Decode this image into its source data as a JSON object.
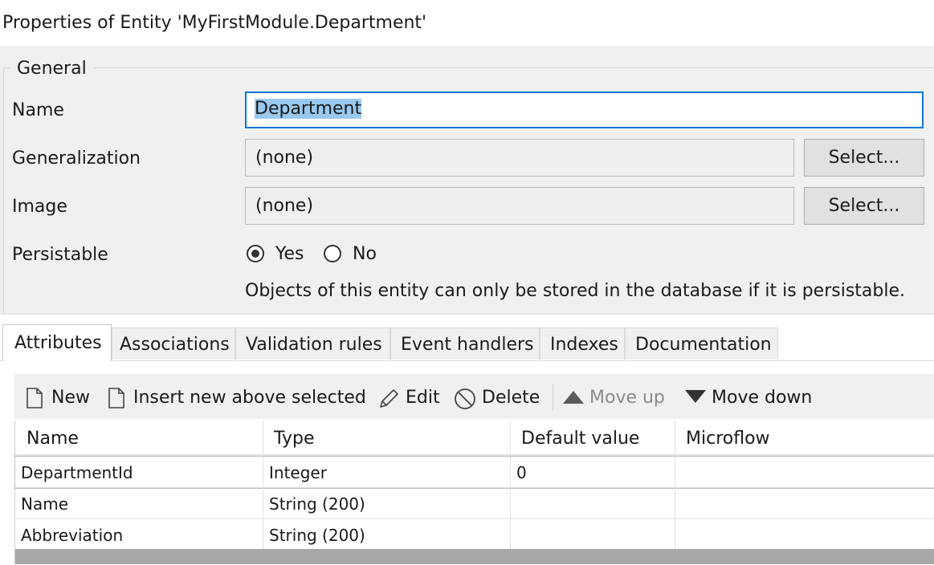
{
  "window": {
    "title": "Properties of Entity 'MyFirstModule.Department'"
  },
  "general": {
    "legend": "General",
    "name_label": "Name",
    "name_value": "Department",
    "generalization_label": "Generalization",
    "generalization_value": "(none)",
    "image_label": "Image",
    "image_value": "(none)",
    "select_button_label": "Select...",
    "persistable_label": "Persistable",
    "persistable_options": [
      {
        "label": "Yes",
        "checked": true
      },
      {
        "label": "No",
        "checked": false
      }
    ],
    "persistable_hint": "Objects of this entity can only be stored in the database if it is persistable."
  },
  "tabs": [
    {
      "label": "Attributes",
      "active": true
    },
    {
      "label": "Associations",
      "active": false
    },
    {
      "label": "Validation rules",
      "active": false
    },
    {
      "label": "Event handlers",
      "active": false
    },
    {
      "label": "Indexes",
      "active": false
    },
    {
      "label": "Documentation",
      "active": false
    }
  ],
  "toolbar": {
    "new_label": "New",
    "insert_label": "Insert new above selected",
    "edit_label": "Edit",
    "delete_label": "Delete",
    "move_up_label": "Move up",
    "move_down_label": "Move down",
    "move_up_enabled": false
  },
  "attributes_table": {
    "columns": [
      "Name",
      "Type",
      "Default value",
      "Microflow"
    ],
    "rows": [
      [
        "DepartmentId",
        "Integer",
        "0",
        ""
      ],
      [
        "Name",
        "String (200)",
        "",
        ""
      ],
      [
        "Abbreviation",
        "String (200)",
        "",
        ""
      ]
    ],
    "selected_row": 0
  },
  "colors": {
    "focus_border": "#0078d7",
    "text_selection": "#99c9ef",
    "panel_bg": "#f0f0f0"
  }
}
